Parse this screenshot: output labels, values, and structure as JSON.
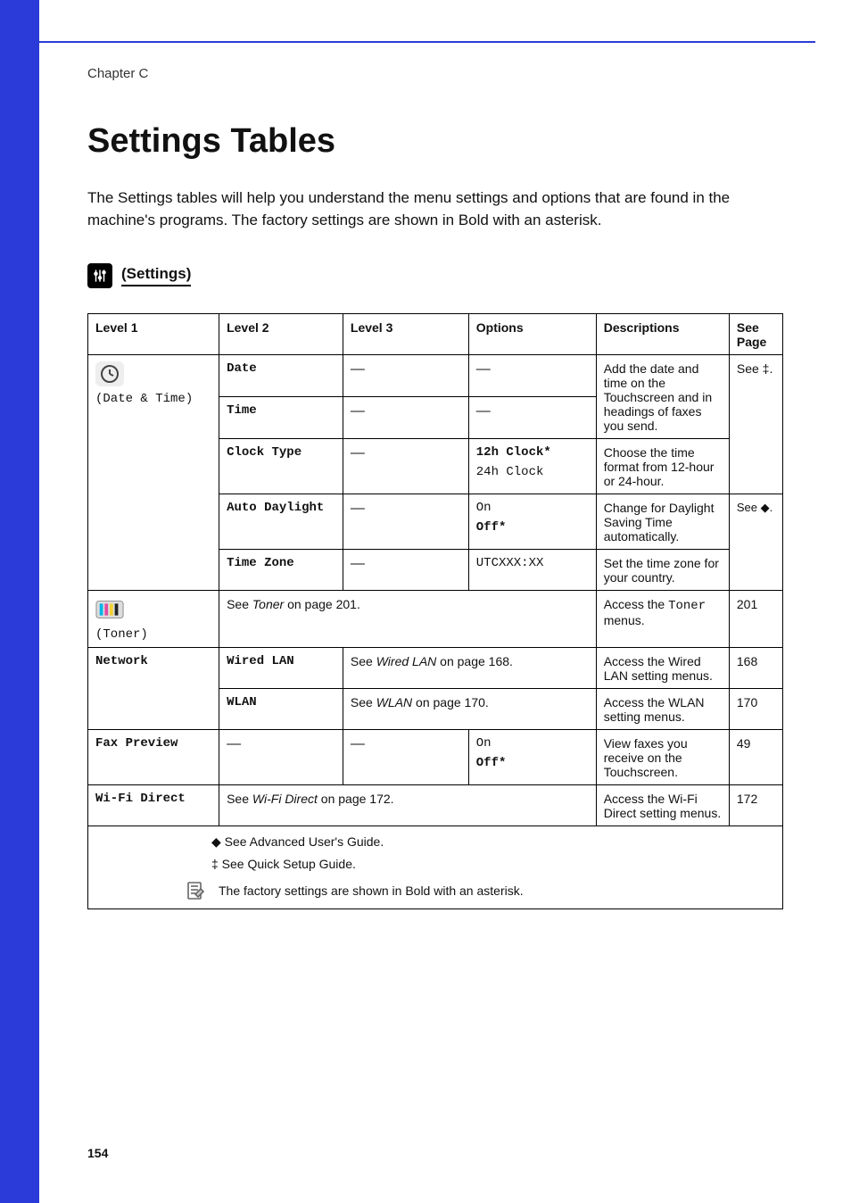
{
  "chapter": "Chapter C",
  "page_title": "Settings Tables",
  "intro": "The Settings tables will help you understand the menu settings and options that are found in the machine's programs. The factory settings are shown in Bold with an asterisk.",
  "settings_header": "(Settings)",
  "table": {
    "headers": {
      "level1": "Level 1",
      "level2": "Level 2",
      "level3": "Level 3",
      "options": "Options",
      "descriptions": "Descriptions",
      "see_page": "See Page"
    },
    "level1": {
      "date_time": "(Date & Time)",
      "toner": "(Toner)",
      "network": "Network",
      "fax_preview": "Fax Preview",
      "wifi_direct": "Wi-Fi Direct"
    },
    "date_time": {
      "date_label": "Date",
      "time_label": "Time",
      "clock_type_label": "Clock Type",
      "clock_type_opt1": "12h Clock*",
      "clock_type_opt2": "24h Clock",
      "auto_daylight_label": "Auto Daylight",
      "auto_daylight_opt1": "On",
      "auto_daylight_opt2": "Off*",
      "time_zone_label": "Time Zone",
      "time_zone_opt": "UTCXXX:XX",
      "desc_date_time": "Add the date and time on the Touchscreen and in headings of faxes you send.",
      "desc_clock_type": "Choose the time format from 12-hour or 24-hour.",
      "desc_auto_daylight": "Change for Daylight Saving Time automatically.",
      "desc_time_zone": "Set the time zone for your country.",
      "see_date": "See ‡.",
      "see_daylight": "See ◆."
    },
    "toner": {
      "ref_prefix": "See ",
      "ref_ital": "Toner",
      "ref_suffix": " on page 201.",
      "desc_prefix": "Access the ",
      "desc_mono": "Toner",
      "desc_suffix": " menus.",
      "page": "201"
    },
    "network": {
      "wired_label": "Wired LAN",
      "wired_ref_prefix": "See ",
      "wired_ref_ital": "Wired LAN",
      "wired_ref_suffix": " on page 168.",
      "wired_desc": "Access the Wired LAN setting menus.",
      "wired_page": "168",
      "wlan_label": "WLAN",
      "wlan_ref_prefix": "See ",
      "wlan_ref_ital": "WLAN",
      "wlan_ref_suffix": " on page 170.",
      "wlan_desc": "Access the WLAN setting menus.",
      "wlan_page": "170"
    },
    "fax_preview": {
      "opt1": "On",
      "opt2": "Off*",
      "desc": "View faxes you receive on the Touchscreen.",
      "page": "49"
    },
    "wifi_direct": {
      "ref_prefix": "See ",
      "ref_ital": "Wi-Fi Direct",
      "ref_suffix": " on page 172.",
      "desc": "Access the Wi-Fi Direct setting menus.",
      "page": "172"
    },
    "footnotes": {
      "diamond": "◆ See Advanced User's Guide.",
      "ddagger": "‡ See Quick Setup Guide.",
      "factory": "The factory settings are shown in Bold with an asterisk."
    }
  },
  "page_number": "154",
  "dash": "—"
}
